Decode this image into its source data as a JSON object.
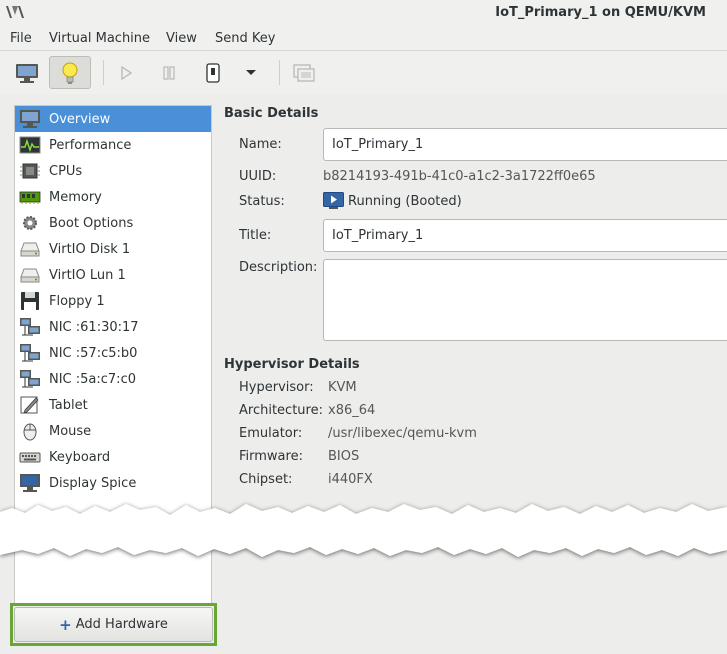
{
  "window": {
    "title": "IoT_Primary_1 on QEMU/KVM",
    "logo_icon": "virt-manager-logo-icon"
  },
  "menubar": {
    "items": [
      "File",
      "Virtual Machine",
      "View",
      "Send Key"
    ]
  },
  "toolbar": {
    "buttons": [
      {
        "icon": "monitor-icon",
        "active": false
      },
      {
        "icon": "lightbulb-icon",
        "active": true
      },
      {
        "icon": "play-icon",
        "active": false
      },
      {
        "icon": "pause-icon",
        "active": false
      },
      {
        "icon": "power-icon",
        "active": false
      },
      {
        "icon": "chevron-down-icon",
        "active": false
      },
      {
        "icon": "fullscreen-icon",
        "active": false
      }
    ]
  },
  "sidebar": {
    "items": [
      {
        "label": "Overview",
        "icon": "monitor-icon",
        "selected": true
      },
      {
        "label": "Performance",
        "icon": "performance-graph-icon",
        "selected": false
      },
      {
        "label": "CPUs",
        "icon": "cpu-chip-icon",
        "selected": false
      },
      {
        "label": "Memory",
        "icon": "memory-module-icon",
        "selected": false
      },
      {
        "label": "Boot Options",
        "icon": "gear-icon",
        "selected": false
      },
      {
        "label": "VirtIO Disk 1",
        "icon": "hard-disk-icon",
        "selected": false
      },
      {
        "label": "VirtIO Lun 1",
        "icon": "hard-disk-icon",
        "selected": false
      },
      {
        "label": "Floppy 1",
        "icon": "floppy-disk-icon",
        "selected": false
      },
      {
        "label": "NIC :61:30:17",
        "icon": "network-icon",
        "selected": false
      },
      {
        "label": "NIC :57:c5:b0",
        "icon": "network-icon",
        "selected": false
      },
      {
        "label": "NIC :5a:c7:c0",
        "icon": "network-icon",
        "selected": false
      },
      {
        "label": "Tablet",
        "icon": "tablet-icon",
        "selected": false
      },
      {
        "label": "Mouse",
        "icon": "mouse-icon",
        "selected": false
      },
      {
        "label": "Keyboard",
        "icon": "keyboard-icon",
        "selected": false
      },
      {
        "label": "Display Spice",
        "icon": "display-icon",
        "selected": false
      }
    ],
    "add_hardware_label": "Add Hardware",
    "add_hardware_icon": "plus-icon"
  },
  "basic_details": {
    "title": "Basic Details",
    "name_label": "Name:",
    "name_value": "IoT_Primary_1",
    "uuid_label": "UUID:",
    "uuid_value": "b8214193-491b-41c0-a1c2-3a1722ff0e65",
    "status_label": "Status:",
    "status_value": "Running (Booted)",
    "status_icon": "running-icon",
    "title_label": "Title:",
    "title_value": "IoT_Primary_1",
    "description_label": "Description:",
    "description_value": ""
  },
  "hypervisor_details": {
    "title": "Hypervisor Details",
    "hypervisor_label": "Hypervisor:",
    "hypervisor_value": "KVM",
    "architecture_label": "Architecture:",
    "architecture_value": "x86_64",
    "emulator_label": "Emulator:",
    "emulator_value": "/usr/libexec/qemu-kvm",
    "firmware_label": "Firmware:",
    "firmware_value": "BIOS",
    "chipset_label": "Chipset:",
    "chipset_value": "i440FX"
  },
  "colors": {
    "selection": "#4a90d9",
    "highlight_border": "#6aa633",
    "window_bg": "#ededeb"
  }
}
